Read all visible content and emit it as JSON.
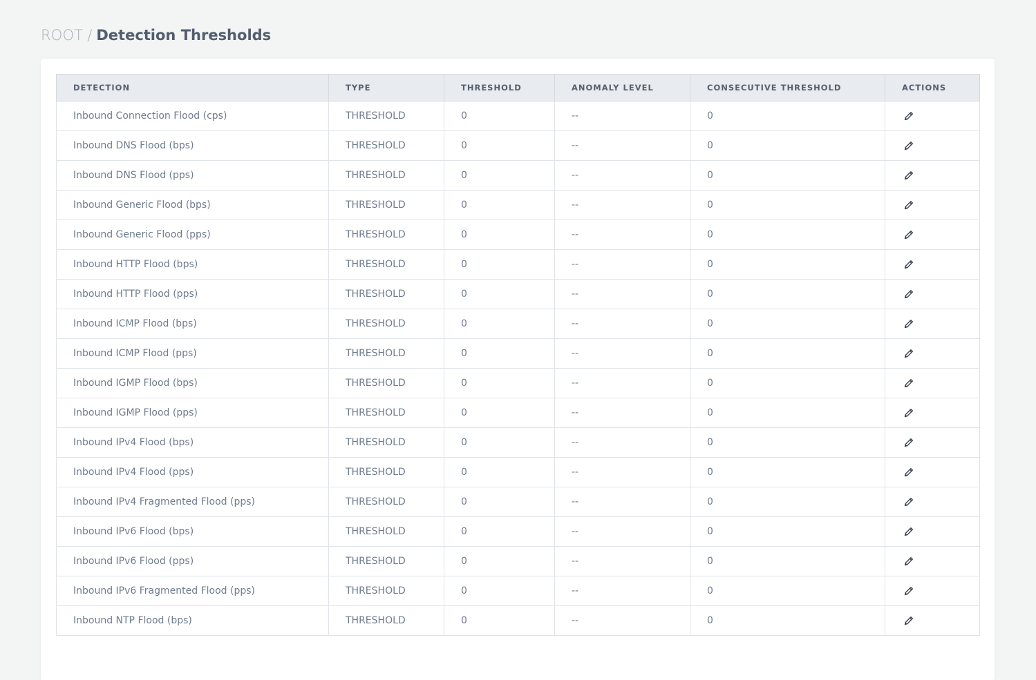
{
  "breadcrumb": {
    "root": "ROOT",
    "separator": "/",
    "current": "Detection Thresholds"
  },
  "table": {
    "columns": [
      "DETECTION",
      "TYPE",
      "THRESHOLD",
      "ANOMALY LEVEL",
      "CONSECUTIVE THRESHOLD",
      "ACTIONS"
    ],
    "rows": [
      {
        "detection": "Inbound Connection Flood (cps)",
        "type": "THRESHOLD",
        "threshold": "0",
        "anomaly_level": "--",
        "consecutive_threshold": "0"
      },
      {
        "detection": "Inbound DNS Flood (bps)",
        "type": "THRESHOLD",
        "threshold": "0",
        "anomaly_level": "--",
        "consecutive_threshold": "0"
      },
      {
        "detection": "Inbound DNS Flood (pps)",
        "type": "THRESHOLD",
        "threshold": "0",
        "anomaly_level": "--",
        "consecutive_threshold": "0"
      },
      {
        "detection": "Inbound Generic Flood (bps)",
        "type": "THRESHOLD",
        "threshold": "0",
        "anomaly_level": "--",
        "consecutive_threshold": "0"
      },
      {
        "detection": "Inbound Generic Flood (pps)",
        "type": "THRESHOLD",
        "threshold": "0",
        "anomaly_level": "--",
        "consecutive_threshold": "0"
      },
      {
        "detection": "Inbound HTTP Flood (bps)",
        "type": "THRESHOLD",
        "threshold": "0",
        "anomaly_level": "--",
        "consecutive_threshold": "0"
      },
      {
        "detection": "Inbound HTTP Flood (pps)",
        "type": "THRESHOLD",
        "threshold": "0",
        "anomaly_level": "--",
        "consecutive_threshold": "0"
      },
      {
        "detection": "Inbound ICMP Flood (bps)",
        "type": "THRESHOLD",
        "threshold": "0",
        "anomaly_level": "--",
        "consecutive_threshold": "0"
      },
      {
        "detection": "Inbound ICMP Flood (pps)",
        "type": "THRESHOLD",
        "threshold": "0",
        "anomaly_level": "--",
        "consecutive_threshold": "0"
      },
      {
        "detection": "Inbound IGMP Flood (bps)",
        "type": "THRESHOLD",
        "threshold": "0",
        "anomaly_level": "--",
        "consecutive_threshold": "0"
      },
      {
        "detection": "Inbound IGMP Flood (pps)",
        "type": "THRESHOLD",
        "threshold": "0",
        "anomaly_level": "--",
        "consecutive_threshold": "0"
      },
      {
        "detection": "Inbound IPv4 Flood (bps)",
        "type": "THRESHOLD",
        "threshold": "0",
        "anomaly_level": "--",
        "consecutive_threshold": "0"
      },
      {
        "detection": "Inbound IPv4 Flood (pps)",
        "type": "THRESHOLD",
        "threshold": "0",
        "anomaly_level": "--",
        "consecutive_threshold": "0"
      },
      {
        "detection": "Inbound IPv4 Fragmented Flood (pps)",
        "type": "THRESHOLD",
        "threshold": "0",
        "anomaly_level": "--",
        "consecutive_threshold": "0"
      },
      {
        "detection": "Inbound IPv6 Flood (bps)",
        "type": "THRESHOLD",
        "threshold": "0",
        "anomaly_level": "--",
        "consecutive_threshold": "0"
      },
      {
        "detection": "Inbound IPv6 Flood (pps)",
        "type": "THRESHOLD",
        "threshold": "0",
        "anomaly_level": "--",
        "consecutive_threshold": "0"
      },
      {
        "detection": "Inbound IPv6 Fragmented Flood (pps)",
        "type": "THRESHOLD",
        "threshold": "0",
        "anomaly_level": "--",
        "consecutive_threshold": "0"
      },
      {
        "detection": "Inbound NTP Flood (bps)",
        "type": "THRESHOLD",
        "threshold": "0",
        "anomaly_level": "--",
        "consecutive_threshold": "0"
      }
    ],
    "row_action_icon": "pencil-icon"
  }
}
